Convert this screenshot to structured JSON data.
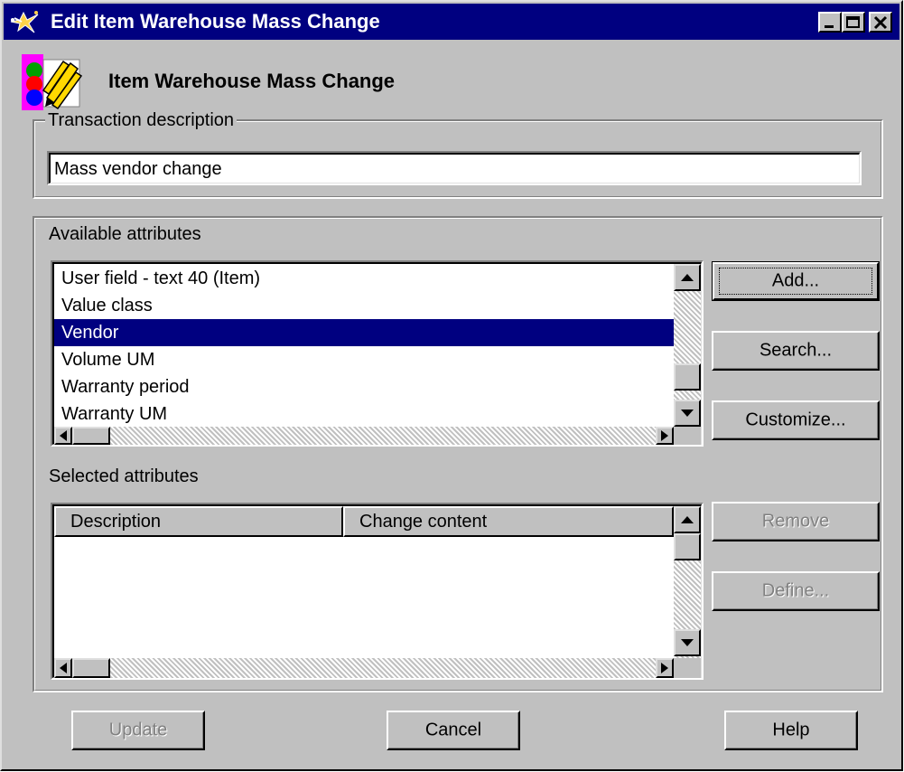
{
  "window": {
    "title": "Edit Item Warehouse Mass Change",
    "header_title": "Item Warehouse Mass Change",
    "title_buttons": [
      "minimize-icon",
      "maximize-icon",
      "close-icon"
    ]
  },
  "transaction": {
    "group_label": "Transaction description",
    "value": "Mass vendor change"
  },
  "available": {
    "label": "Available attributes",
    "items": [
      {
        "label": "User field - text 40   (Item)",
        "selected": false
      },
      {
        "label": "Value class",
        "selected": false
      },
      {
        "label": "Vendor",
        "selected": true
      },
      {
        "label": "Volume UM",
        "selected": false
      },
      {
        "label": "Warranty period",
        "selected": false
      },
      {
        "label": "Warranty UM",
        "selected": false
      }
    ],
    "buttons": {
      "add": "Add...",
      "search": "Search...",
      "customize": "Customize..."
    }
  },
  "selected": {
    "label": "Selected attributes",
    "columns": [
      "Description",
      "Change content"
    ],
    "rows": [],
    "buttons": {
      "remove": "Remove",
      "define": "Define..."
    }
  },
  "footer": {
    "update": "Update",
    "cancel": "Cancel",
    "help": "Help"
  },
  "colors": {
    "titlebar": "#000080",
    "face": "#c0c0c0",
    "selection": "#000080"
  }
}
